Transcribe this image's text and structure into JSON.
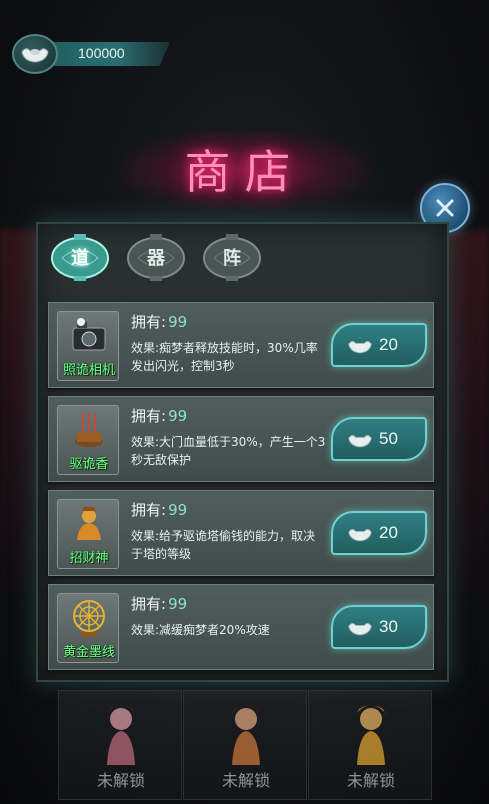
{
  "currency": {
    "amount": "100000",
    "icon": "silver-ingot-icon"
  },
  "title": "商店",
  "close": {
    "icon": "close-icon"
  },
  "tabs": [
    {
      "label": "道",
      "active": true
    },
    {
      "label": "器",
      "active": false
    },
    {
      "label": "阵",
      "active": false
    }
  ],
  "items": [
    {
      "name": "照诡相机",
      "own_label": "拥有:",
      "own_count": "99",
      "desc": "效果:痴梦者释放技能时，30%几率发出闪光，控制3秒",
      "price": "20",
      "icon": "camera-icon"
    },
    {
      "name": "驱诡香",
      "own_label": "拥有:",
      "own_count": "99",
      "desc": "效果:大门血量低于30%，产生一个3秒无敌保护",
      "price": "50",
      "icon": "incense-icon"
    },
    {
      "name": "招财神",
      "own_label": "拥有:",
      "own_count": "99",
      "desc": "效果:给予驱诡塔偷钱的能力，取决于塔的等级",
      "price": "20",
      "icon": "fortune-god-icon"
    },
    {
      "name": "黄金墨线",
      "own_label": "拥有:",
      "own_count": "99",
      "desc": "效果:减缓痴梦者20%攻速",
      "price": "30",
      "icon": "golden-web-icon"
    }
  ],
  "locked_slots": [
    {
      "label": "未解锁"
    },
    {
      "label": "未解锁"
    },
    {
      "label": "未解锁"
    }
  ],
  "colors": {
    "accent": "#6fd2cf",
    "title": "#ff8fb4",
    "item_name": "#6dff8a"
  }
}
